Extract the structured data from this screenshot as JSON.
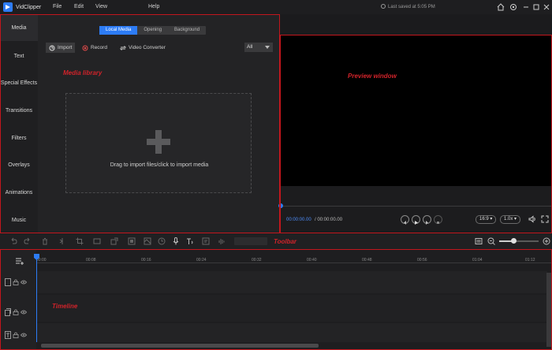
{
  "app": {
    "name": "VidClipper",
    "saved_status": "Last saved at 5:05 PM"
  },
  "menu": [
    {
      "label": "File"
    },
    {
      "label": "Edit"
    },
    {
      "label": "View"
    },
    {
      "label": "Help"
    }
  ],
  "sidebar": {
    "items": [
      {
        "label": "Media"
      },
      {
        "label": "Text"
      },
      {
        "label": "Special Effects"
      },
      {
        "label": "Transitions"
      },
      {
        "label": "Filters"
      },
      {
        "label": "Overlays"
      },
      {
        "label": "Animations"
      },
      {
        "label": "Music"
      }
    ]
  },
  "media": {
    "tabs": [
      {
        "label": "Local Media"
      },
      {
        "label": "Opening"
      },
      {
        "label": "Background"
      }
    ],
    "import_label": "Import",
    "record_label": "Record",
    "converter_label": "Video Converter",
    "filter_value": "All",
    "drop_text": "Drag to import files/click to import media"
  },
  "player": {
    "current_time": "00:00:00.00",
    "total_time": "/ 00:00:00.00",
    "aspect": "16:9",
    "speed": "1.0x"
  },
  "annotations": {
    "media_library": "Media library",
    "preview_window": "Preview window",
    "toolbar": "Toolbar",
    "timeline": "Timeline"
  },
  "timeline": {
    "ticks": [
      "00:00",
      "00:08",
      "00:16",
      "00:24",
      "00:32",
      "00:40",
      "00:48",
      "00:56",
      "01:04",
      "01:12"
    ]
  },
  "colors": {
    "accent": "#2d7cf6",
    "annotation": "#d0232a"
  }
}
